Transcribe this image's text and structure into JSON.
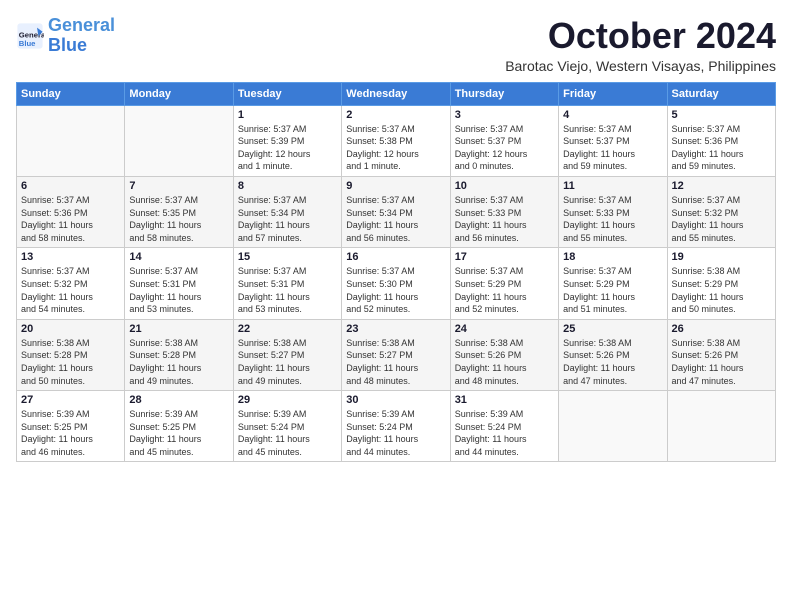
{
  "logo": {
    "line1": "General",
    "line2": "Blue"
  },
  "title": "October 2024",
  "subtitle": "Barotac Viejo, Western Visayas, Philippines",
  "days_of_week": [
    "Sunday",
    "Monday",
    "Tuesday",
    "Wednesday",
    "Thursday",
    "Friday",
    "Saturday"
  ],
  "weeks": [
    [
      {
        "day": "",
        "info": ""
      },
      {
        "day": "",
        "info": ""
      },
      {
        "day": "1",
        "info": "Sunrise: 5:37 AM\nSunset: 5:39 PM\nDaylight: 12 hours\nand 1 minute."
      },
      {
        "day": "2",
        "info": "Sunrise: 5:37 AM\nSunset: 5:38 PM\nDaylight: 12 hours\nand 1 minute."
      },
      {
        "day": "3",
        "info": "Sunrise: 5:37 AM\nSunset: 5:37 PM\nDaylight: 12 hours\nand 0 minutes."
      },
      {
        "day": "4",
        "info": "Sunrise: 5:37 AM\nSunset: 5:37 PM\nDaylight: 11 hours\nand 59 minutes."
      },
      {
        "day": "5",
        "info": "Sunrise: 5:37 AM\nSunset: 5:36 PM\nDaylight: 11 hours\nand 59 minutes."
      }
    ],
    [
      {
        "day": "6",
        "info": "Sunrise: 5:37 AM\nSunset: 5:36 PM\nDaylight: 11 hours\nand 58 minutes."
      },
      {
        "day": "7",
        "info": "Sunrise: 5:37 AM\nSunset: 5:35 PM\nDaylight: 11 hours\nand 58 minutes."
      },
      {
        "day": "8",
        "info": "Sunrise: 5:37 AM\nSunset: 5:34 PM\nDaylight: 11 hours\nand 57 minutes."
      },
      {
        "day": "9",
        "info": "Sunrise: 5:37 AM\nSunset: 5:34 PM\nDaylight: 11 hours\nand 56 minutes."
      },
      {
        "day": "10",
        "info": "Sunrise: 5:37 AM\nSunset: 5:33 PM\nDaylight: 11 hours\nand 56 minutes."
      },
      {
        "day": "11",
        "info": "Sunrise: 5:37 AM\nSunset: 5:33 PM\nDaylight: 11 hours\nand 55 minutes."
      },
      {
        "day": "12",
        "info": "Sunrise: 5:37 AM\nSunset: 5:32 PM\nDaylight: 11 hours\nand 55 minutes."
      }
    ],
    [
      {
        "day": "13",
        "info": "Sunrise: 5:37 AM\nSunset: 5:32 PM\nDaylight: 11 hours\nand 54 minutes."
      },
      {
        "day": "14",
        "info": "Sunrise: 5:37 AM\nSunset: 5:31 PM\nDaylight: 11 hours\nand 53 minutes."
      },
      {
        "day": "15",
        "info": "Sunrise: 5:37 AM\nSunset: 5:31 PM\nDaylight: 11 hours\nand 53 minutes."
      },
      {
        "day": "16",
        "info": "Sunrise: 5:37 AM\nSunset: 5:30 PM\nDaylight: 11 hours\nand 52 minutes."
      },
      {
        "day": "17",
        "info": "Sunrise: 5:37 AM\nSunset: 5:29 PM\nDaylight: 11 hours\nand 52 minutes."
      },
      {
        "day": "18",
        "info": "Sunrise: 5:37 AM\nSunset: 5:29 PM\nDaylight: 11 hours\nand 51 minutes."
      },
      {
        "day": "19",
        "info": "Sunrise: 5:38 AM\nSunset: 5:29 PM\nDaylight: 11 hours\nand 50 minutes."
      }
    ],
    [
      {
        "day": "20",
        "info": "Sunrise: 5:38 AM\nSunset: 5:28 PM\nDaylight: 11 hours\nand 50 minutes."
      },
      {
        "day": "21",
        "info": "Sunrise: 5:38 AM\nSunset: 5:28 PM\nDaylight: 11 hours\nand 49 minutes."
      },
      {
        "day": "22",
        "info": "Sunrise: 5:38 AM\nSunset: 5:27 PM\nDaylight: 11 hours\nand 49 minutes."
      },
      {
        "day": "23",
        "info": "Sunrise: 5:38 AM\nSunset: 5:27 PM\nDaylight: 11 hours\nand 48 minutes."
      },
      {
        "day": "24",
        "info": "Sunrise: 5:38 AM\nSunset: 5:26 PM\nDaylight: 11 hours\nand 48 minutes."
      },
      {
        "day": "25",
        "info": "Sunrise: 5:38 AM\nSunset: 5:26 PM\nDaylight: 11 hours\nand 47 minutes."
      },
      {
        "day": "26",
        "info": "Sunrise: 5:38 AM\nSunset: 5:26 PM\nDaylight: 11 hours\nand 47 minutes."
      }
    ],
    [
      {
        "day": "27",
        "info": "Sunrise: 5:39 AM\nSunset: 5:25 PM\nDaylight: 11 hours\nand 46 minutes."
      },
      {
        "day": "28",
        "info": "Sunrise: 5:39 AM\nSunset: 5:25 PM\nDaylight: 11 hours\nand 45 minutes."
      },
      {
        "day": "29",
        "info": "Sunrise: 5:39 AM\nSunset: 5:24 PM\nDaylight: 11 hours\nand 45 minutes."
      },
      {
        "day": "30",
        "info": "Sunrise: 5:39 AM\nSunset: 5:24 PM\nDaylight: 11 hours\nand 44 minutes."
      },
      {
        "day": "31",
        "info": "Sunrise: 5:39 AM\nSunset: 5:24 PM\nDaylight: 11 hours\nand 44 minutes."
      },
      {
        "day": "",
        "info": ""
      },
      {
        "day": "",
        "info": ""
      }
    ]
  ]
}
